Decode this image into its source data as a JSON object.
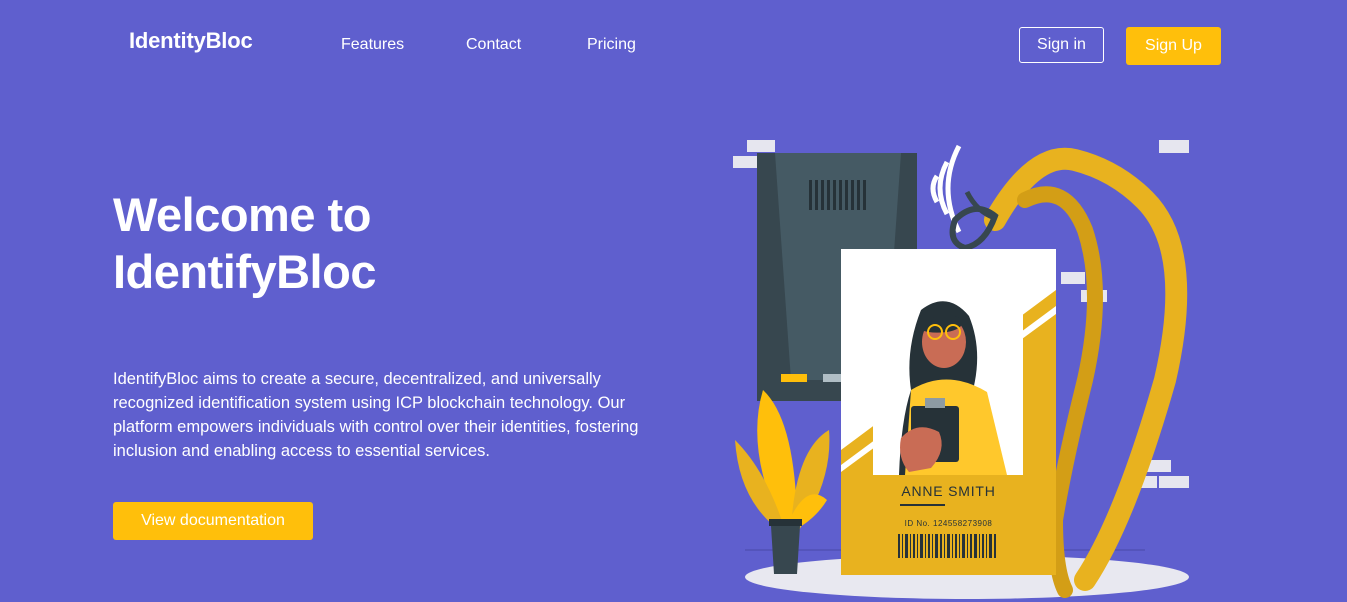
{
  "nav": {
    "logo": "IdentityBloc",
    "links": [
      "Features",
      "Contact",
      "Pricing"
    ],
    "signin_label": "Sign in",
    "signup_label": "Sign Up"
  },
  "hero": {
    "title_line1": "Welcome to",
    "title_line2": "IdentifyBloc",
    "description": "IdentifyBloc aims to create a secure, decentralized, and universally recognized identification system using ICP blockchain technology. Our platform empowers individuals with control over their identities, fostering inclusion and enabling access to essential services.",
    "cta_label": "View documentation"
  },
  "illustration": {
    "card_name": "ANNE SMITH",
    "card_id": "ID No. 124558273908"
  },
  "colors": {
    "background": "#5f5fce",
    "accent": "#ffbf0b",
    "card_yellow": "#e8b21f",
    "dark": "#37474f"
  }
}
